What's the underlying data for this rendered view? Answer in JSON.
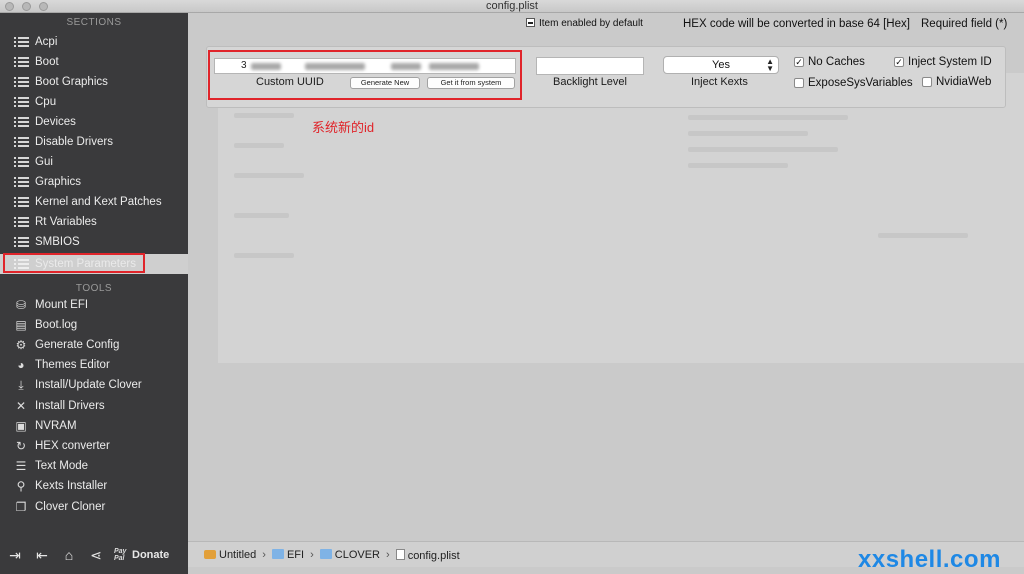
{
  "window": {
    "title": "config.plist"
  },
  "sidebar": {
    "sections_header": "SECTIONS",
    "sections": [
      {
        "label": "Acpi",
        "name": "sidebar-item-acpi"
      },
      {
        "label": "Boot",
        "name": "sidebar-item-boot"
      },
      {
        "label": "Boot Graphics",
        "name": "sidebar-item-boot-graphics"
      },
      {
        "label": "Cpu",
        "name": "sidebar-item-cpu"
      },
      {
        "label": "Devices",
        "name": "sidebar-item-devices"
      },
      {
        "label": "Disable Drivers",
        "name": "sidebar-item-disable-drivers"
      },
      {
        "label": "Gui",
        "name": "sidebar-item-gui"
      },
      {
        "label": "Graphics",
        "name": "sidebar-item-graphics"
      },
      {
        "label": "Kernel and Kext Patches",
        "name": "sidebar-item-kernel-kext-patches"
      },
      {
        "label": "Rt Variables",
        "name": "sidebar-item-rt-variables"
      },
      {
        "label": "SMBIOS",
        "name": "sidebar-item-smbios"
      },
      {
        "label": "System Parameters",
        "name": "sidebar-item-system-parameters",
        "selected": true
      }
    ],
    "tools_header": "TOOLS",
    "tools": [
      {
        "label": "Mount EFI",
        "icon": "disk-icon"
      },
      {
        "label": "Boot.log",
        "icon": "log-icon"
      },
      {
        "label": "Generate Config",
        "icon": "gears-icon"
      },
      {
        "label": "Themes Editor",
        "icon": "palette-icon"
      },
      {
        "label": "Install/Update Clover",
        "icon": "download-icon"
      },
      {
        "label": "Install Drivers",
        "icon": "tools-icon"
      },
      {
        "label": "NVRAM",
        "icon": "chip-icon"
      },
      {
        "label": "HEX converter",
        "icon": "refresh-icon"
      },
      {
        "label": "Text Mode",
        "icon": "text-icon"
      },
      {
        "label": "Kexts Installer",
        "icon": "plug-icon"
      },
      {
        "label": "Clover Cloner",
        "icon": "clone-icon"
      }
    ],
    "footer": {
      "paypal_line1": "Pay",
      "paypal_line2": "Pal",
      "donate_label": "Donate"
    }
  },
  "header": {
    "item_enabled_default": "Item enabled by default",
    "hex_note": "HEX code will be converted in base 64 [Hex]",
    "required_note": "Required field (*)"
  },
  "params": {
    "custom_uuid": {
      "label": "Custom UUID",
      "value_prefix": "3",
      "generate_new": "Generate New",
      "get_from_system": "Get it from system"
    },
    "backlight_level": {
      "label": "Backlight Level",
      "value": ""
    },
    "inject_kexts": {
      "label": "Inject Kexts",
      "value": "Yes"
    },
    "checkboxes": {
      "no_caches": {
        "label": "No Caches",
        "checked": true
      },
      "inject_system_id": {
        "label": "Inject System ID",
        "checked": true
      },
      "expose_sys_variables": {
        "label": "ExposeSysVariables",
        "checked": false
      },
      "nvidia_web": {
        "label": "NvidiaWeb",
        "checked": false
      }
    }
  },
  "annotation": {
    "text": "系统新的id"
  },
  "pathbar": {
    "items": [
      "Untitled",
      "EFI",
      "CLOVER",
      "config.plist"
    ]
  },
  "watermark": {
    "text": "xxshell.com"
  },
  "colors": {
    "sidebar_bg": "#3a3a3c",
    "annotation_red": "#e0242a",
    "watermark_blue": "#1e88e5"
  }
}
